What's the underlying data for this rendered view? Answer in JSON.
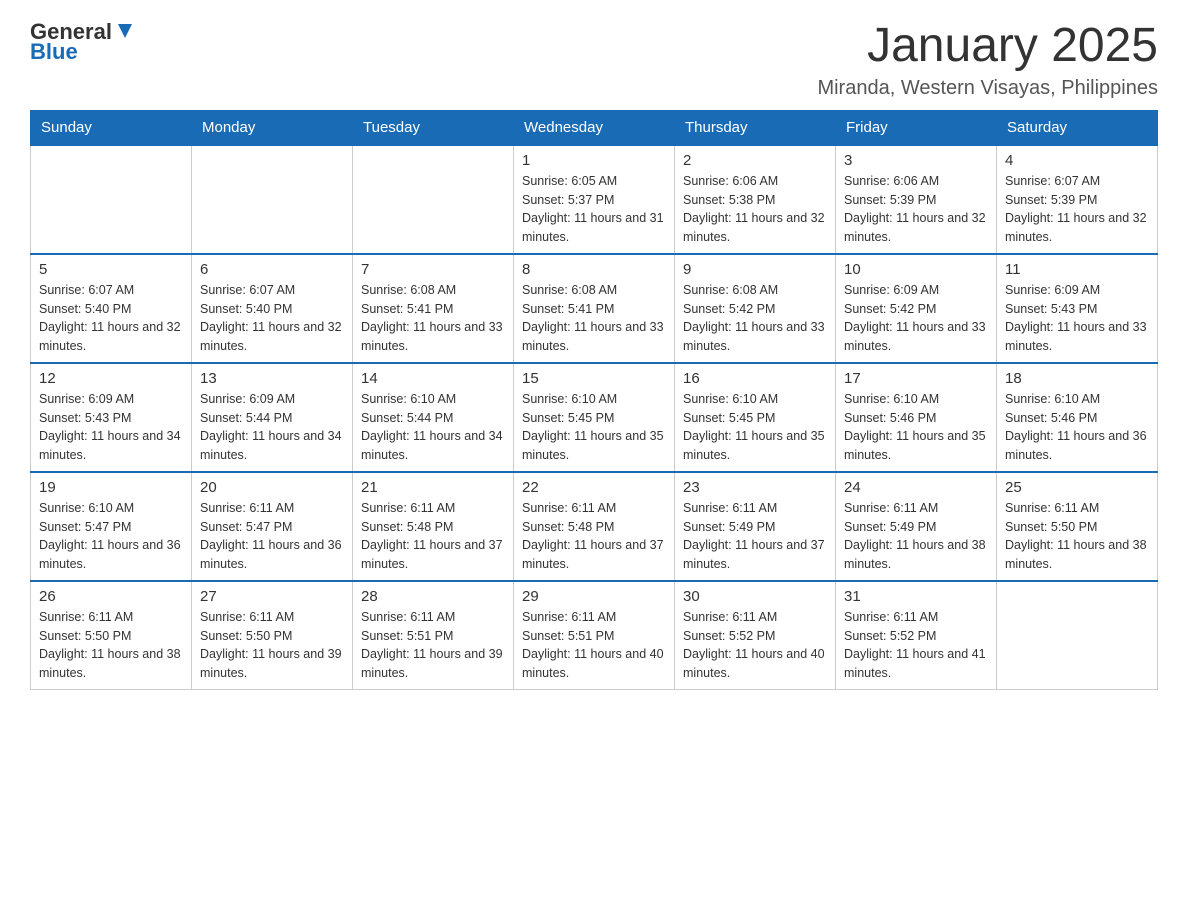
{
  "header": {
    "logo": {
      "text_general": "General",
      "text_blue": "Blue"
    },
    "title": "January 2025",
    "subtitle": "Miranda, Western Visayas, Philippines"
  },
  "calendar": {
    "days_of_week": [
      "Sunday",
      "Monday",
      "Tuesday",
      "Wednesday",
      "Thursday",
      "Friday",
      "Saturday"
    ],
    "weeks": [
      [
        {
          "day": "",
          "info": ""
        },
        {
          "day": "",
          "info": ""
        },
        {
          "day": "",
          "info": ""
        },
        {
          "day": "1",
          "info": "Sunrise: 6:05 AM\nSunset: 5:37 PM\nDaylight: 11 hours and 31 minutes."
        },
        {
          "day": "2",
          "info": "Sunrise: 6:06 AM\nSunset: 5:38 PM\nDaylight: 11 hours and 32 minutes."
        },
        {
          "day": "3",
          "info": "Sunrise: 6:06 AM\nSunset: 5:39 PM\nDaylight: 11 hours and 32 minutes."
        },
        {
          "day": "4",
          "info": "Sunrise: 6:07 AM\nSunset: 5:39 PM\nDaylight: 11 hours and 32 minutes."
        }
      ],
      [
        {
          "day": "5",
          "info": "Sunrise: 6:07 AM\nSunset: 5:40 PM\nDaylight: 11 hours and 32 minutes."
        },
        {
          "day": "6",
          "info": "Sunrise: 6:07 AM\nSunset: 5:40 PM\nDaylight: 11 hours and 32 minutes."
        },
        {
          "day": "7",
          "info": "Sunrise: 6:08 AM\nSunset: 5:41 PM\nDaylight: 11 hours and 33 minutes."
        },
        {
          "day": "8",
          "info": "Sunrise: 6:08 AM\nSunset: 5:41 PM\nDaylight: 11 hours and 33 minutes."
        },
        {
          "day": "9",
          "info": "Sunrise: 6:08 AM\nSunset: 5:42 PM\nDaylight: 11 hours and 33 minutes."
        },
        {
          "day": "10",
          "info": "Sunrise: 6:09 AM\nSunset: 5:42 PM\nDaylight: 11 hours and 33 minutes."
        },
        {
          "day": "11",
          "info": "Sunrise: 6:09 AM\nSunset: 5:43 PM\nDaylight: 11 hours and 33 minutes."
        }
      ],
      [
        {
          "day": "12",
          "info": "Sunrise: 6:09 AM\nSunset: 5:43 PM\nDaylight: 11 hours and 34 minutes."
        },
        {
          "day": "13",
          "info": "Sunrise: 6:09 AM\nSunset: 5:44 PM\nDaylight: 11 hours and 34 minutes."
        },
        {
          "day": "14",
          "info": "Sunrise: 6:10 AM\nSunset: 5:44 PM\nDaylight: 11 hours and 34 minutes."
        },
        {
          "day": "15",
          "info": "Sunrise: 6:10 AM\nSunset: 5:45 PM\nDaylight: 11 hours and 35 minutes."
        },
        {
          "day": "16",
          "info": "Sunrise: 6:10 AM\nSunset: 5:45 PM\nDaylight: 11 hours and 35 minutes."
        },
        {
          "day": "17",
          "info": "Sunrise: 6:10 AM\nSunset: 5:46 PM\nDaylight: 11 hours and 35 minutes."
        },
        {
          "day": "18",
          "info": "Sunrise: 6:10 AM\nSunset: 5:46 PM\nDaylight: 11 hours and 36 minutes."
        }
      ],
      [
        {
          "day": "19",
          "info": "Sunrise: 6:10 AM\nSunset: 5:47 PM\nDaylight: 11 hours and 36 minutes."
        },
        {
          "day": "20",
          "info": "Sunrise: 6:11 AM\nSunset: 5:47 PM\nDaylight: 11 hours and 36 minutes."
        },
        {
          "day": "21",
          "info": "Sunrise: 6:11 AM\nSunset: 5:48 PM\nDaylight: 11 hours and 37 minutes."
        },
        {
          "day": "22",
          "info": "Sunrise: 6:11 AM\nSunset: 5:48 PM\nDaylight: 11 hours and 37 minutes."
        },
        {
          "day": "23",
          "info": "Sunrise: 6:11 AM\nSunset: 5:49 PM\nDaylight: 11 hours and 37 minutes."
        },
        {
          "day": "24",
          "info": "Sunrise: 6:11 AM\nSunset: 5:49 PM\nDaylight: 11 hours and 38 minutes."
        },
        {
          "day": "25",
          "info": "Sunrise: 6:11 AM\nSunset: 5:50 PM\nDaylight: 11 hours and 38 minutes."
        }
      ],
      [
        {
          "day": "26",
          "info": "Sunrise: 6:11 AM\nSunset: 5:50 PM\nDaylight: 11 hours and 38 minutes."
        },
        {
          "day": "27",
          "info": "Sunrise: 6:11 AM\nSunset: 5:50 PM\nDaylight: 11 hours and 39 minutes."
        },
        {
          "day": "28",
          "info": "Sunrise: 6:11 AM\nSunset: 5:51 PM\nDaylight: 11 hours and 39 minutes."
        },
        {
          "day": "29",
          "info": "Sunrise: 6:11 AM\nSunset: 5:51 PM\nDaylight: 11 hours and 40 minutes."
        },
        {
          "day": "30",
          "info": "Sunrise: 6:11 AM\nSunset: 5:52 PM\nDaylight: 11 hours and 40 minutes."
        },
        {
          "day": "31",
          "info": "Sunrise: 6:11 AM\nSunset: 5:52 PM\nDaylight: 11 hours and 41 minutes."
        },
        {
          "day": "",
          "info": ""
        }
      ]
    ]
  }
}
